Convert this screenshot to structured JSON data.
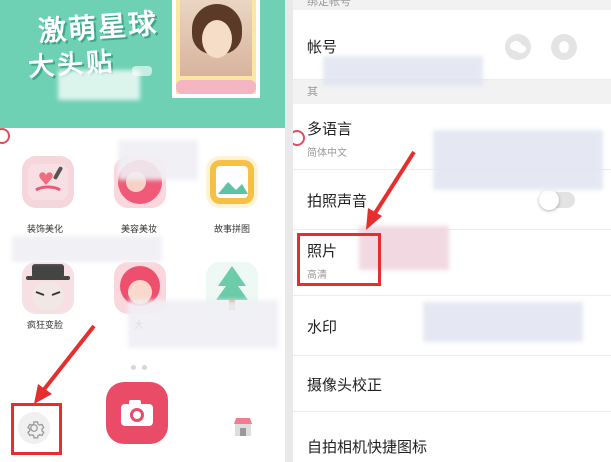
{
  "left": {
    "banner": {
      "title": "激萌星球",
      "subtitle": "大头贴"
    },
    "grid": [
      {
        "label": "装饰美化",
        "color": "#f06a80"
      },
      {
        "label": "美容美妆",
        "color": "#ee5a78"
      },
      {
        "label": "故事拼图",
        "color": "#f6c045"
      },
      {
        "label": "疯狂变脸",
        "color": "#f28aa0"
      },
      {
        "label": "大",
        "color": "#ee4f6d"
      },
      {
        "label": "",
        "color": "#8cd4b8"
      }
    ],
    "bottom": {
      "settings_icon": "gear-icon",
      "camera_icon": "camera-icon",
      "shop_icon": "shop-icon"
    }
  },
  "right": {
    "sections": {
      "bind_account": "绑定帐号",
      "other": "其"
    },
    "rows": {
      "account": {
        "title": "帐号"
      },
      "language": {
        "title": "多语言",
        "sub": "简体中文"
      },
      "shutter_sound": {
        "title": "拍照声音"
      },
      "photo_quality": {
        "title": "照片",
        "sub": "高清"
      },
      "watermark": {
        "title": "水印"
      },
      "camera_calibration": {
        "title": "摄像头校正"
      },
      "shortcut": {
        "title": "自拍相机快捷图标"
      }
    }
  },
  "colors": {
    "accent": "#ea4c67",
    "banner": "#6fd1b3",
    "highlight": "#e52f2f"
  }
}
